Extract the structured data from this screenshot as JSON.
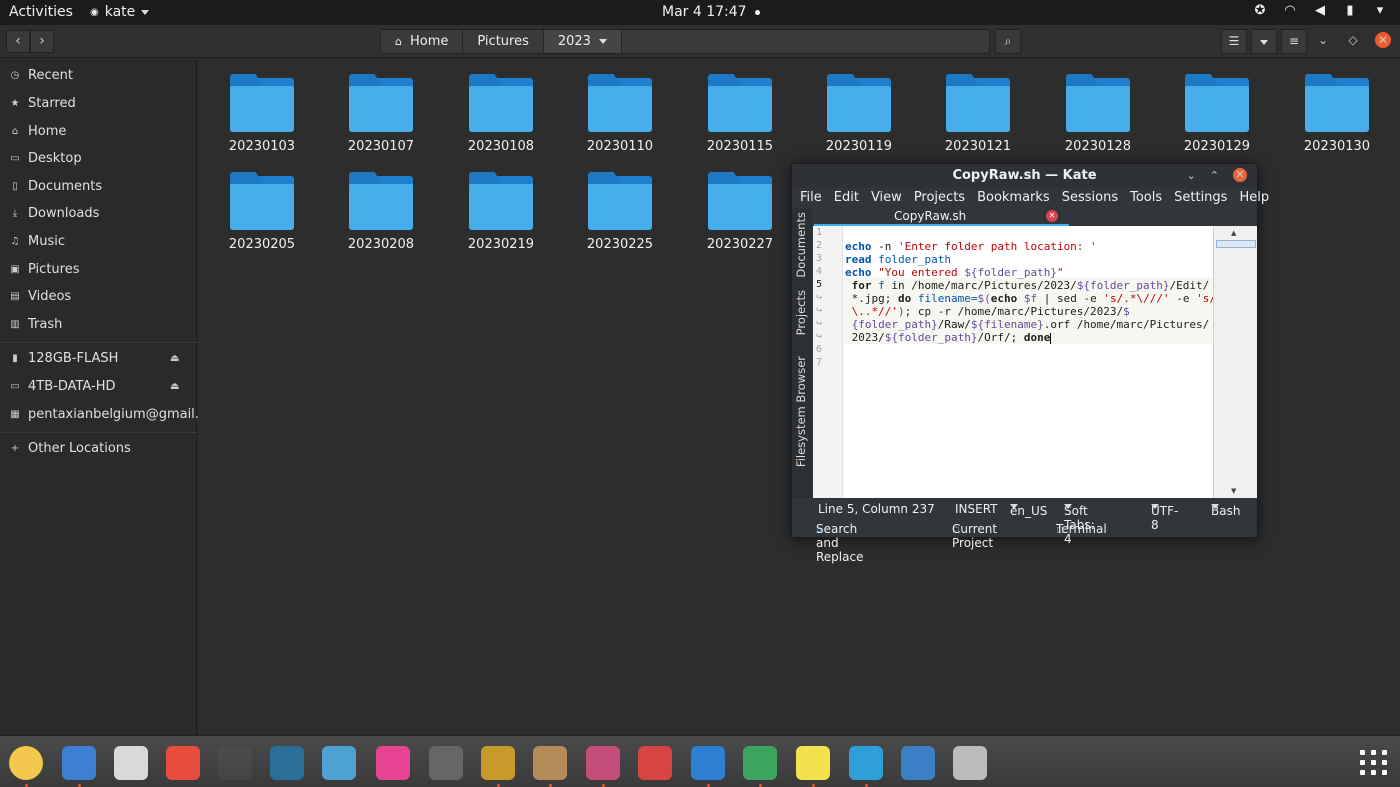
{
  "topbar": {
    "activities": "Activities",
    "app_name": "kate",
    "clock": "Mar 4  17:47"
  },
  "files": {
    "breadcrumb": [
      "Home",
      "Pictures",
      "2023"
    ],
    "sidebar": {
      "places": [
        "Recent",
        "Starred",
        "Home",
        "Desktop",
        "Documents",
        "Downloads",
        "Music",
        "Pictures",
        "Videos",
        "Trash"
      ],
      "devices": [
        "128GB-FLASH",
        "4TB-DATA-HD",
        "pentaxianbelgium@gmail...."
      ],
      "other": "Other Locations"
    },
    "folders": [
      "20230103",
      "20230107",
      "20230108",
      "20230110",
      "20230115",
      "20230119",
      "20230121",
      "20230128",
      "20230129",
      "20230130",
      "20230205",
      "20230208",
      "20230219",
      "20230225",
      "20230227"
    ]
  },
  "kate": {
    "title": "CopyRaw.sh  — Kate",
    "menu": [
      "File",
      "Edit",
      "View",
      "Projects",
      "Bookmarks",
      "Sessions",
      "Tools",
      "Settings",
      "Help"
    ],
    "side_tabs": [
      "Documents",
      "Projects",
      "Filesystem Browser"
    ],
    "doc_tab": "CopyRaw.sh",
    "line_numbers": [
      "1",
      "2",
      "3",
      "4",
      "5",
      "↪",
      "↪",
      "↪",
      "↪",
      "6",
      "7"
    ],
    "code": {
      "l2_a": "echo",
      "l2_b": " -n ",
      "l2_c": "'Enter folder path location: '",
      "l3_a": "read",
      "l3_b": " folder_path",
      "l4_a": "echo",
      "l4_b": " \"You entered ",
      "l4_c": "${folder_path}",
      "l4_d": "\"",
      "l5a_a": " for",
      "l5a_b": " f",
      "l5a_c": " in /home/marc/Pictures/2023/",
      "l5a_d": "${folder_path}",
      "l5a_e": "/Edit/",
      "l5b_a": " *.jpg; ",
      "l5b_b": "do",
      "l5b_c": " filename=",
      "l5b_d": "$(",
      "l5b_e": "echo",
      "l5b_f": " $f",
      "l5b_g": " | ",
      "l5b_h": "sed",
      "l5b_i": " -e ",
      "l5b_j": "'s/.*\\///'",
      "l5b_k": " -e ",
      "l5b_l": "'s/",
      "l5c_a": " \\..*//'",
      "l5c_b": ")",
      "l5c_c": "; ",
      "l5c_d": "cp",
      "l5c_e": " -r /home/marc/Pictures/2023/",
      "l5c_f": "$",
      "l5d_a": " {folder_path}",
      "l5d_b": "/Raw/",
      "l5d_c": "${filename}",
      "l5d_d": ".orf /home/marc/Pictures/",
      "l5e_a": " 2023/",
      "l5e_b": "${folder_path}",
      "l5e_c": "/Orf/; ",
      "l5e_d": "done"
    },
    "status": {
      "position": "Line 5, Column 237",
      "mode": "INSERT",
      "lang": "en_US",
      "tabs": "Soft Tabs: 4",
      "encoding": "UTF-8",
      "syntax": "Bash"
    },
    "toolviews": [
      "Search and Replace",
      "Current Project",
      "Terminal"
    ]
  },
  "dock": [
    "disk-usage-icon",
    "files-icon",
    "rhythmbox-icon",
    "help-icon",
    "blank-icon",
    "books-icon",
    "gimp-icon",
    "color-icon",
    "scanner-icon",
    "brasero-icon",
    "photos-icon",
    "shotwell-icon",
    "sdcard-icon",
    "thunderbird-icon",
    "chrome-icon",
    "notes-icon",
    "kate-icon",
    "usb-icon",
    "drive-icon",
    "app-grid-icon"
  ],
  "colors": {
    "folder_blue": "#45aeeb",
    "accent_orange": "#ef5a2a",
    "kate_accent": "#3daee9"
  }
}
